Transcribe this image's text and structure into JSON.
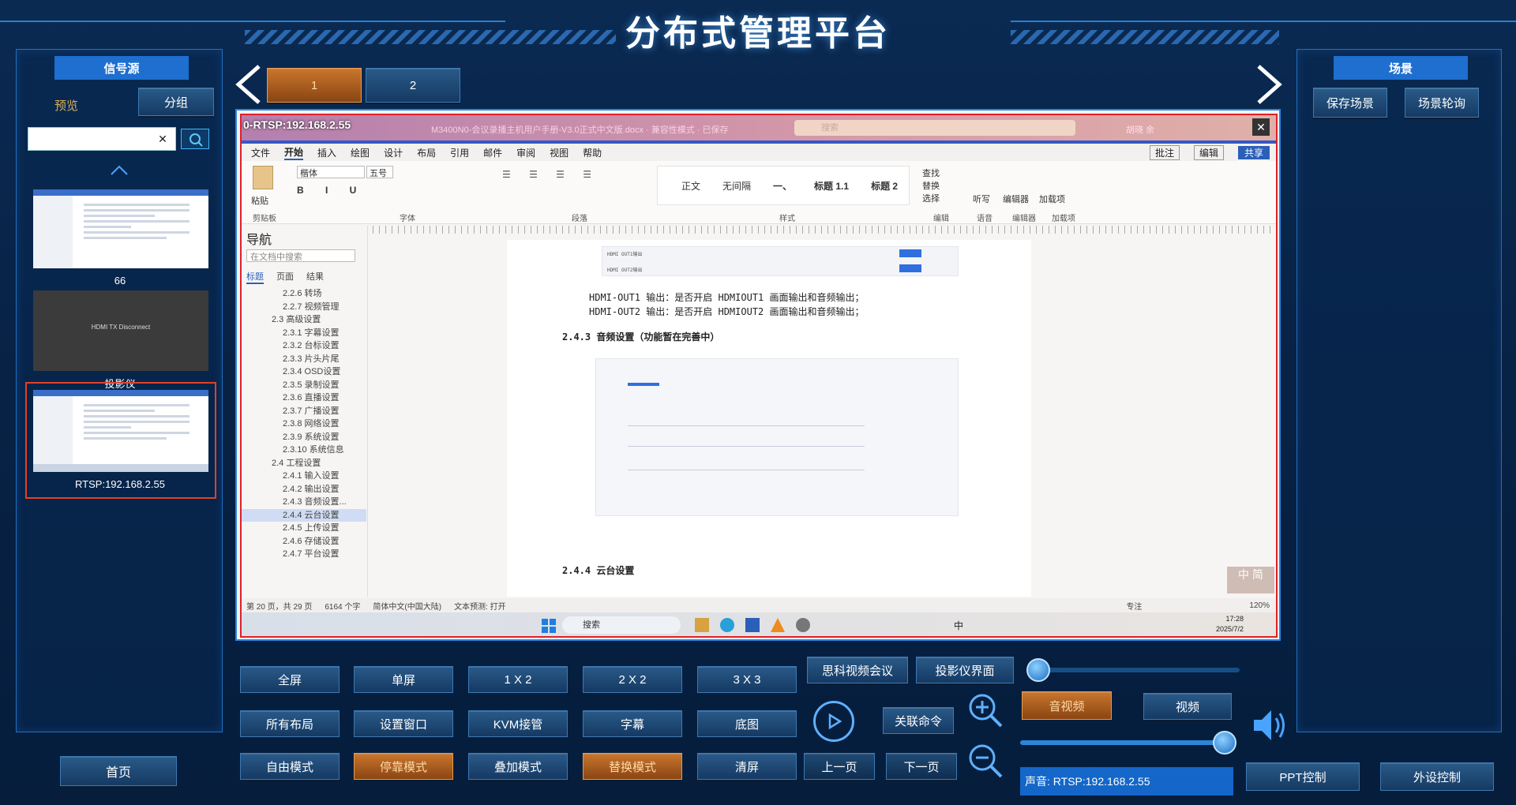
{
  "header": {
    "title": "分布式管理平台"
  },
  "left_panel": {
    "tab": "信号源",
    "preview_label": "预览",
    "group_button": "分组",
    "search": {
      "value": "",
      "placeholder": ""
    },
    "clear_glyph": "✕",
    "sources": [
      {
        "label": "66"
      },
      {
        "label": "投影仪",
        "screen_text": "HDMI TX Disconnect"
      },
      {
        "label": "RTSP:192.168.2.55"
      }
    ],
    "home_button": "首页"
  },
  "pager": {
    "pages": [
      "1",
      "2"
    ],
    "active": "1"
  },
  "screen": {
    "overlay_label": "0-RTSP:192.168.2.55",
    "word": {
      "doc_title": "M3400N0-会议录播主机用户手册-V3.0正式中文版.docx · 兼容性模式 · 已保存",
      "search_placeholder": "搜索",
      "user": "胡晓 余",
      "tabs": [
        "文件",
        "开始",
        "插入",
        "绘图",
        "设计",
        "布局",
        "引用",
        "邮件",
        "审阅",
        "视图",
        "帮助"
      ],
      "right_buttons": [
        "批注",
        "编辑",
        "共享"
      ],
      "font_name": "楷体",
      "font_size": "五号",
      "styles": [
        "正文",
        "无间隔",
        "一、",
        "标题 1.1",
        "标题 2"
      ],
      "groups": [
        "剪贴板",
        "字体",
        "段落",
        "样式",
        "编辑",
        "语音",
        "编辑器",
        "加载项"
      ],
      "right_tools": [
        "查找",
        "替换",
        "选择",
        "听写",
        "编辑器",
        "加载项"
      ],
      "paste_label": "粘贴",
      "nav": {
        "title": "导航",
        "search_placeholder": "在文档中搜索",
        "tabs": [
          "标题",
          "页面",
          "结果"
        ],
        "items": [
          "2.2.6 转场",
          "2.2.7 视频管理",
          "2.3 高级设置",
          "2.3.1 字幕设置",
          "2.3.2 台标设置",
          "2.3.3 片头片尾",
          "2.3.4 OSD设置",
          "2.3.5 录制设置",
          "2.3.6 直播设置",
          "2.3.7 广播设置",
          "2.3.8 网络设置",
          "2.3.9 系统设置",
          "2.3.10 系统信息",
          "2.4 工程设置",
          "2.4.1 输入设置",
          "2.4.2 输出设置",
          "2.4.3 音频设置...",
          "2.4.4 云台设置",
          "2.4.5 上传设置",
          "2.4.6 存储设置",
          "2.4.7 平台设置"
        ]
      },
      "page_lines": [
        "HDMI-OUT1 输出：是否开启 HDMIOUT1 画面输出和音频输出；",
        "HDMI-OUT2 输出：是否开启 HDMIOUT2 画面输出和音频输出；"
      ],
      "section_243": "2.4.3    音频设置（功能暂在完善中）",
      "section_244": "2.4.4    云台设置",
      "embed_rows": [
        "HDMI OUT1输出",
        "HDMI OUT2输出"
      ],
      "status": [
        "第 20 页，共 29 页",
        "6164 个字",
        "简体中文(中国大陆)",
        "文本预测: 打开",
        "专注",
        "120%"
      ],
      "taskbar_search": "搜索",
      "ime": "中",
      "ime_badge": "中 简",
      "clock_time": "17:28",
      "clock_date": "2025/7/2"
    }
  },
  "layout_buttons": [
    [
      "全屏",
      "单屏",
      "1 X 2",
      "2 X 2",
      "3 X 3"
    ],
    [
      "所有布局",
      "设置窗口",
      "KVM接管",
      "字幕",
      "底图"
    ],
    [
      "自由模式",
      "停靠模式",
      "叠加模式",
      "替换模式",
      "清屏"
    ]
  ],
  "mid_controls": {
    "cisco": "思科视频会议",
    "projector_ui": "投影仪界面",
    "link_cmd": "关联命令",
    "prev_page": "上一页",
    "next_page": "下一页"
  },
  "audio": {
    "av_button": "音视频",
    "video_button": "视频",
    "volume_source": "声音: RTSP:192.168.2.55",
    "volume_level": 0.96,
    "top_slider_level": 0.0,
    "ppt": "PPT控制",
    "peripheral": "外设控制"
  },
  "right_panel": {
    "tab": "场景",
    "save_scene": "保存场景",
    "scene_poll": "场景轮询"
  },
  "colors": {
    "accent": "#1e6fd0",
    "orange": "#c9762e",
    "highlight": "#e0202a"
  }
}
